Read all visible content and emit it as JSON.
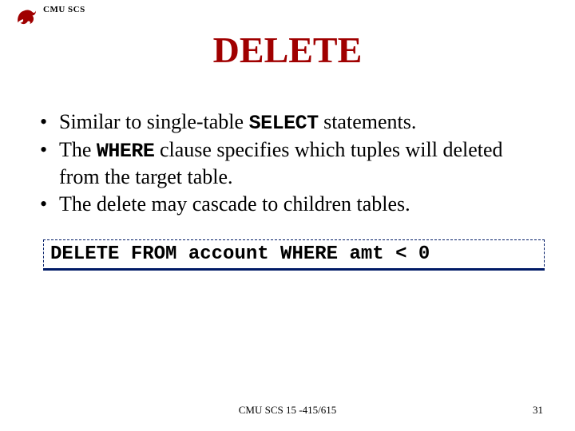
{
  "header": {
    "org": "CMU SCS"
  },
  "title": "DELETE",
  "bullets": [
    {
      "pre": "Similar to single-table ",
      "kw": "SELECT",
      "post": " statements."
    },
    {
      "pre": "The ",
      "kw": "WHERE",
      "post": " clause specifies which tuples will deleted from the target table."
    },
    {
      "pre": "The delete may cascade to children tables.",
      "kw": "",
      "post": ""
    }
  ],
  "code": "DELETE FROM account WHERE amt < 0",
  "footer": {
    "center": "CMU SCS 15 -415/615",
    "page": "31"
  }
}
